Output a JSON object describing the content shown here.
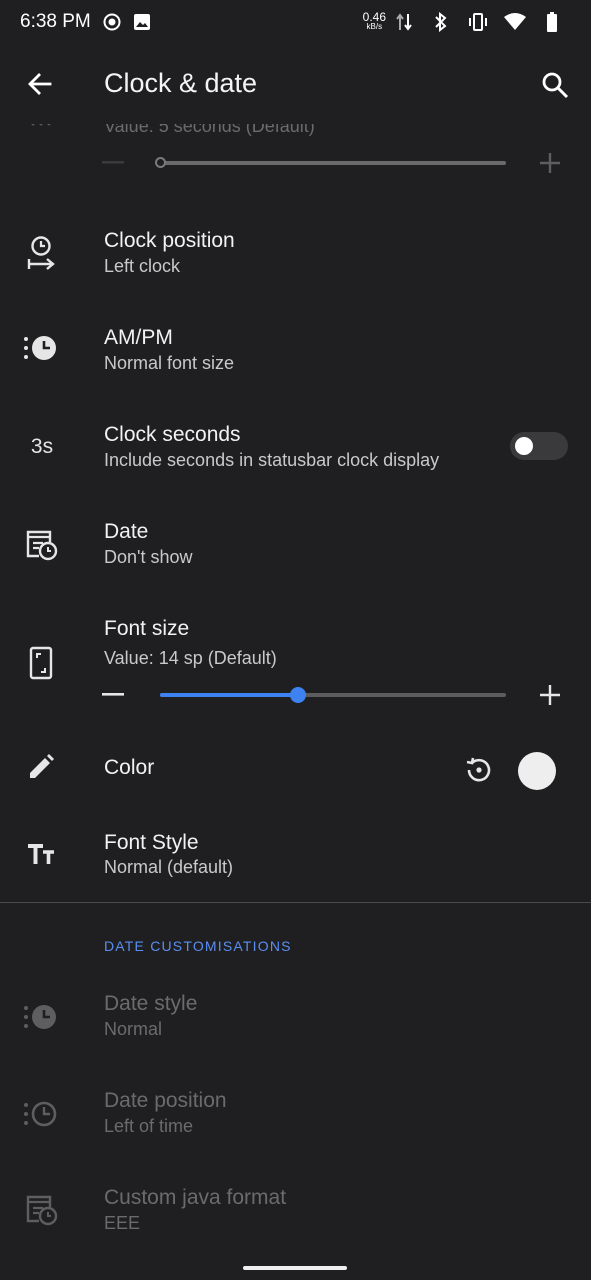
{
  "statusbar": {
    "time": "6:38 PM",
    "net_speed": "0.46",
    "net_unit": "kB/s",
    "icons": [
      "record-icon",
      "image-icon",
      "data-arrows-icon",
      "bluetooth-icon",
      "vibrate-icon",
      "wifi-icon",
      "battery-icon"
    ]
  },
  "appbar": {
    "title": "Clock & date",
    "back_icon": "arrow-back-icon",
    "search_icon": "search-icon"
  },
  "top_partial": {
    "subtitle": "Value: 5 seconds (Default)",
    "slider_fraction": 0
  },
  "items": {
    "clock_position": {
      "title": "Clock position",
      "subtitle": "Left clock",
      "icon": "clock-position-icon"
    },
    "ampm": {
      "title": "AM/PM",
      "subtitle": "Normal font size",
      "icon": "ampm-clock-icon"
    },
    "clock_seconds": {
      "title": "Clock seconds",
      "subtitle": "Include seconds in statusbar clock display",
      "icon_text": "3s",
      "toggle_on": false
    },
    "date": {
      "title": "Date",
      "subtitle": "Don't show",
      "icon": "date-calendar-icon"
    },
    "font_size": {
      "title": "Font size",
      "subtitle": "Value: 14 sp (Default)",
      "icon": "phone-icon",
      "slider_fraction": 0.4
    },
    "color": {
      "title": "Color",
      "icon": "pencil-icon",
      "reset_icon": "reset-icon",
      "swatch": "#eeeeee"
    },
    "font_style": {
      "title": "Font Style",
      "subtitle": "Normal (default)",
      "icon": "text-size-icon"
    }
  },
  "section": {
    "header": "DATE CUSTOMISATIONS"
  },
  "date_items": {
    "date_style": {
      "title": "Date style",
      "subtitle": "Normal",
      "icon": "date-style-icon"
    },
    "date_position": {
      "title": "Date position",
      "subtitle": "Left of time",
      "icon": "date-position-icon"
    },
    "custom_java_format": {
      "title": "Custom java format",
      "subtitle": "EEE",
      "icon": "date-calendar-icon"
    }
  },
  "colors": {
    "background": "#1f1f21",
    "accent": "#3d82f0",
    "section_header": "#5a8ef0"
  }
}
